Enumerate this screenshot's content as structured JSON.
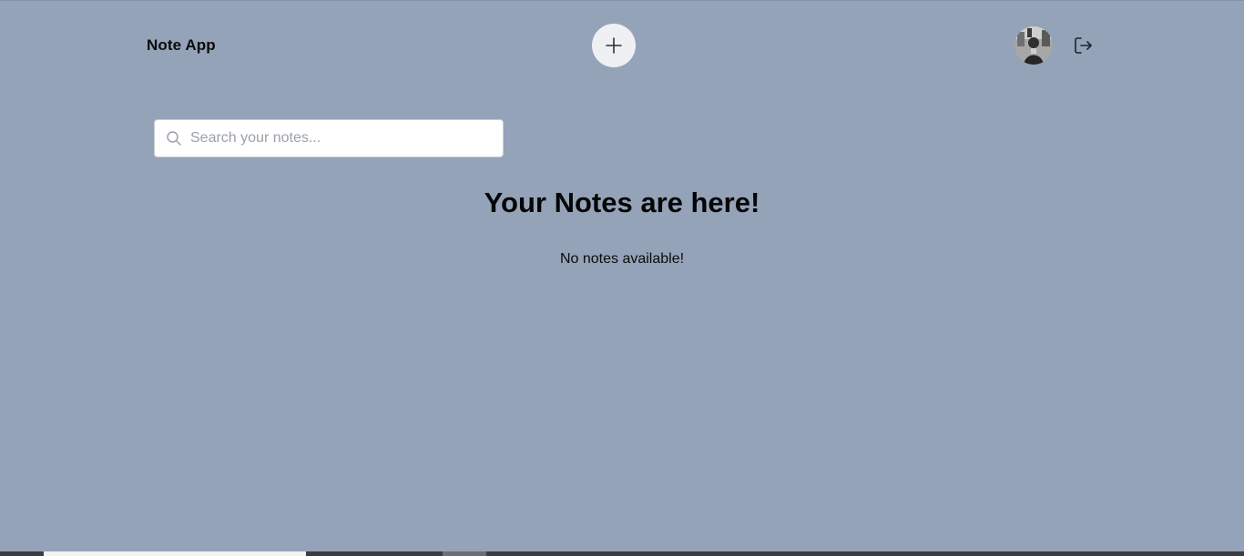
{
  "header": {
    "app_title": "Note App",
    "add_button_icon": "plus-icon",
    "avatar_icon": "user-avatar",
    "logout_icon": "logout-icon"
  },
  "search": {
    "placeholder": "Search your notes...",
    "value": "",
    "icon": "search-icon"
  },
  "main": {
    "heading": "Your Notes are here!",
    "empty_message": "No notes available!"
  },
  "colors": {
    "background": "#94a3b8",
    "add_button_bg": "#eef0f3",
    "search_bg": "#ffffff",
    "text": "#0a0a0a"
  }
}
